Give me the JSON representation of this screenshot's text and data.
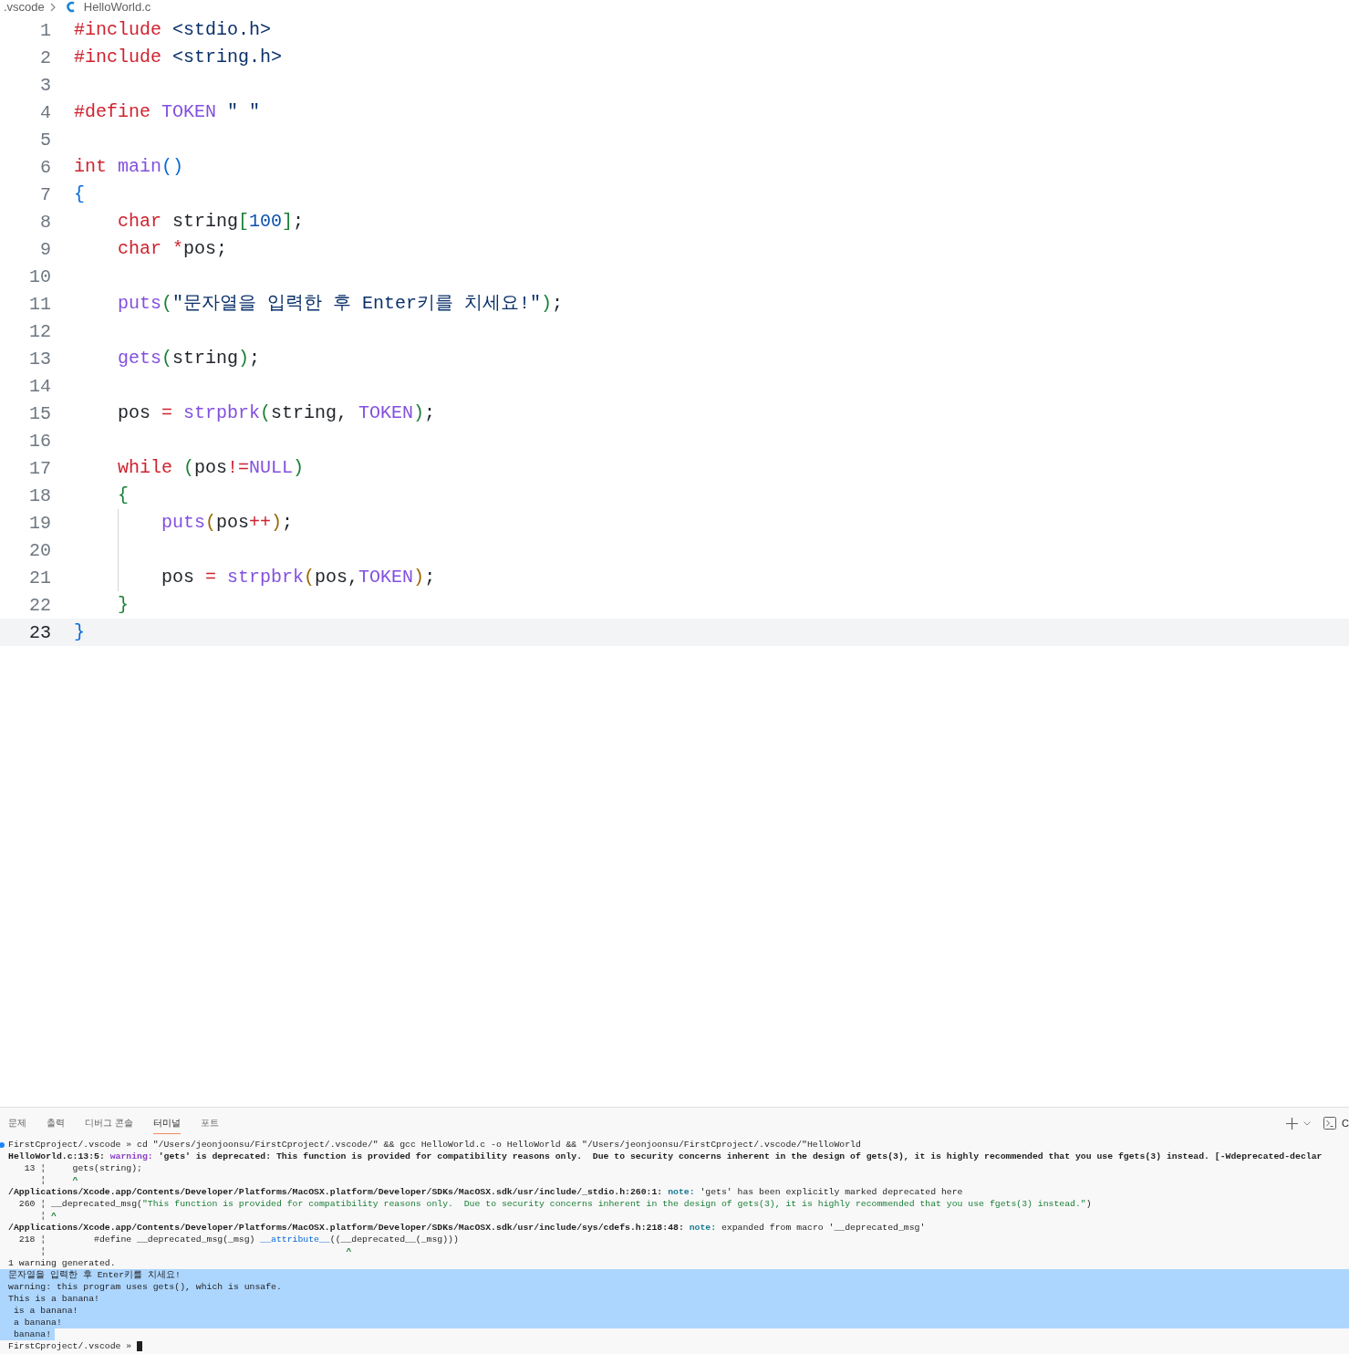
{
  "breadcrumb": {
    "folder": ".vscode",
    "file": "HelloWorld.c"
  },
  "editor": {
    "lines": [
      {
        "number": "1",
        "current": false,
        "guide": false,
        "tokens": [
          {
            "text": "#include",
            "kind": "kw"
          },
          {
            "text": " <stdio.h>",
            "kind": "str"
          }
        ]
      },
      {
        "number": "2",
        "current": false,
        "guide": false,
        "tokens": [
          {
            "text": "#include",
            "kind": "kw"
          },
          {
            "text": " <string.h>",
            "kind": "str"
          }
        ]
      },
      {
        "number": "3",
        "current": false,
        "guide": false
      },
      {
        "number": "4",
        "current": false,
        "guide": false,
        "tokens": [
          {
            "text": "#define",
            "kind": "kw"
          },
          {
            "text": " TOKEN",
            "kind": "macro"
          },
          {
            "text": " \" \"",
            "kind": "str"
          }
        ]
      },
      {
        "number": "5",
        "current": false,
        "guide": false
      },
      {
        "number": "6",
        "current": false,
        "guide": false,
        "tokens": [
          {
            "text": "int",
            "kind": "kw"
          },
          {
            "text": " main",
            "kind": "fn"
          },
          {
            "text": "()",
            "kind": "b1"
          }
        ]
      },
      {
        "number": "7",
        "current": false,
        "guide": false,
        "tokens": [
          {
            "text": "{",
            "kind": "b1"
          }
        ]
      },
      {
        "number": "8",
        "current": false,
        "guide": false,
        "tokens": [
          {
            "text": "    char",
            "kind": "kw"
          },
          {
            "text": " string",
            "kind": "plain"
          },
          {
            "text": "[",
            "kind": "b2"
          },
          {
            "text": "100",
            "kind": "num"
          },
          {
            "text": "]",
            "kind": "b2"
          },
          {
            "text": ";",
            "kind": "plain"
          }
        ]
      },
      {
        "number": "9",
        "current": false,
        "guide": false,
        "tokens": [
          {
            "text": "    char",
            "kind": "kw"
          },
          {
            "text": " *",
            "kind": "op"
          },
          {
            "text": "pos;",
            "kind": "plain"
          }
        ]
      },
      {
        "number": "10",
        "current": false,
        "guide": false
      },
      {
        "number": "11",
        "current": false,
        "guide": false,
        "tokens": [
          {
            "text": "    puts",
            "kind": "fn"
          },
          {
            "text": "(",
            "kind": "b2"
          },
          {
            "text": "\"문자열을 입력한 후 Enter키를 치세요!\"",
            "kind": "str"
          },
          {
            "text": ")",
            "kind": "b2"
          },
          {
            "text": ";",
            "kind": "plain"
          }
        ]
      },
      {
        "number": "12",
        "current": false,
        "guide": false
      },
      {
        "number": "13",
        "current": false,
        "guide": false,
        "tokens": [
          {
            "text": "    gets",
            "kind": "fn"
          },
          {
            "text": "(",
            "kind": "b2"
          },
          {
            "text": "string",
            "kind": "plain"
          },
          {
            "text": ")",
            "kind": "b2"
          },
          {
            "text": ";",
            "kind": "plain"
          }
        ]
      },
      {
        "number": "14",
        "current": false,
        "guide": false
      },
      {
        "number": "15",
        "current": false,
        "guide": false,
        "tokens": [
          {
            "text": "    pos ",
            "kind": "plain"
          },
          {
            "text": "=",
            "kind": "op"
          },
          {
            "text": " strpbrk",
            "kind": "fn"
          },
          {
            "text": "(",
            "kind": "b2"
          },
          {
            "text": "string, ",
            "kind": "plain"
          },
          {
            "text": "TOKEN",
            "kind": "macro"
          },
          {
            "text": ")",
            "kind": "b2"
          },
          {
            "text": ";",
            "kind": "plain"
          }
        ]
      },
      {
        "number": "16",
        "current": false,
        "guide": false
      },
      {
        "number": "17",
        "current": false,
        "guide": false,
        "tokens": [
          {
            "text": "    while",
            "kind": "kw"
          },
          {
            "text": " (",
            "kind": "b2"
          },
          {
            "text": "pos",
            "kind": "plain"
          },
          {
            "text": "!=",
            "kind": "op"
          },
          {
            "text": "NULL",
            "kind": "macro"
          },
          {
            "text": ")",
            "kind": "b2"
          }
        ]
      },
      {
        "number": "18",
        "current": false,
        "guide": false,
        "tokens": [
          {
            "text": "    {",
            "kind": "b2"
          }
        ]
      },
      {
        "number": "19",
        "current": false,
        "guide": true,
        "tokens": [
          {
            "text": "        puts",
            "kind": "fn"
          },
          {
            "text": "(",
            "kind": "b3"
          },
          {
            "text": "pos",
            "kind": "plain"
          },
          {
            "text": "++",
            "kind": "op"
          },
          {
            "text": ")",
            "kind": "b3"
          },
          {
            "text": ";",
            "kind": "plain"
          }
        ]
      },
      {
        "number": "20",
        "current": false,
        "guide": true
      },
      {
        "number": "21",
        "current": false,
        "guide": true,
        "tokens": [
          {
            "text": "        pos ",
            "kind": "plain"
          },
          {
            "text": "=",
            "kind": "op"
          },
          {
            "text": " strpbrk",
            "kind": "fn"
          },
          {
            "text": "(",
            "kind": "b3"
          },
          {
            "text": "pos,",
            "kind": "plain"
          },
          {
            "text": "TOKEN",
            "kind": "macro"
          },
          {
            "text": ")",
            "kind": "b3"
          },
          {
            "text": ";",
            "kind": "plain"
          }
        ]
      },
      {
        "number": "22",
        "current": false,
        "guide": false,
        "tokens": [
          {
            "text": "    }",
            "kind": "b2"
          }
        ]
      },
      {
        "number": "23",
        "current": true,
        "guide": false,
        "tokens": [
          {
            "text": "}",
            "kind": "b1"
          }
        ]
      }
    ]
  },
  "panel": {
    "tabs": [
      {
        "label": "문제",
        "selected": false
      },
      {
        "label": "출력",
        "selected": false
      },
      {
        "label": "디버그 콘솔",
        "selected": false
      },
      {
        "label": "터미널",
        "selected": true
      },
      {
        "label": "포트",
        "selected": false
      }
    ],
    "terminal_label": "C",
    "terminal": [
      {
        "marker": true,
        "selected": false,
        "cursor": false,
        "parts": [
          {
            "text": "FirstCproject/.vscode » cd \"/Users/jeonjoonsu/FirstCproject/.vscode/\" && gcc HelloWorld.c -o HelloWorld && \"/Users/jeonjoonsu/FirstCproject/.vscode/\"HelloWorld",
            "kind": "plain"
          }
        ]
      },
      {
        "marker": false,
        "selected": false,
        "cursor": false,
        "parts": [
          {
            "text": "HelloWorld.c:13:5: ",
            "kind": "bold"
          },
          {
            "text": "warning:",
            "kind": "warning"
          },
          {
            "text": " 'gets' is deprecated: This function is provided for compatibility reasons only.  Due to security concerns inherent in the design of gets(3), it is highly recommended that you use fgets(3) instead. [-Wdeprecated-declar",
            "kind": "bold"
          }
        ]
      },
      {
        "marker": false,
        "selected": false,
        "cursor": false,
        "parts": [
          {
            "text": "   13 ¦     gets(string);",
            "kind": "plain"
          }
        ]
      },
      {
        "marker": false,
        "selected": false,
        "cursor": false,
        "parts": [
          {
            "text": "      ¦     ",
            "kind": "plain"
          },
          {
            "text": "^",
            "kind": "caret"
          }
        ]
      },
      {
        "marker": false,
        "selected": false,
        "cursor": false,
        "parts": [
          {
            "text": "/Applications/Xcode.app/Contents/Developer/Platforms/MacOSX.platform/Developer/SDKs/MacOSX.sdk/usr/include/_stdio.h:260:1: ",
            "kind": "bold"
          },
          {
            "text": "note:",
            "kind": "note"
          },
          {
            "text": " 'gets' has been explicitly marked deprecated here",
            "kind": "plain"
          }
        ]
      },
      {
        "marker": false,
        "selected": false,
        "cursor": false,
        "parts": [
          {
            "text": "  260 ¦ __deprecated_msg(",
            "kind": "plain"
          },
          {
            "text": "\"This function is provided for compatibility reasons only.  Due to security concerns inherent in the design of gets(3), it is highly recommended that you use fgets(3) instead.\"",
            "kind": "string"
          },
          {
            "text": ")",
            "kind": "plain"
          }
        ]
      },
      {
        "marker": false,
        "selected": false,
        "cursor": false,
        "parts": [
          {
            "text": "      ¦ ",
            "kind": "plain"
          },
          {
            "text": "^",
            "kind": "caret"
          }
        ]
      },
      {
        "marker": false,
        "selected": false,
        "cursor": false,
        "parts": [
          {
            "text": "/Applications/Xcode.app/Contents/Developer/Platforms/MacOSX.platform/Developer/SDKs/MacOSX.sdk/usr/include/sys/cdefs.h:218:48: ",
            "kind": "bold"
          },
          {
            "text": "note:",
            "kind": "note"
          },
          {
            "text": " expanded from macro '__deprecated_msg'",
            "kind": "plain"
          }
        ]
      },
      {
        "marker": false,
        "selected": false,
        "cursor": false,
        "parts": [
          {
            "text": "  218 ¦         #define __deprecated_msg(_msg) ",
            "kind": "plain"
          },
          {
            "text": "__attribute__",
            "kind": "attr"
          },
          {
            "text": "((__deprecated__(_msg)))",
            "kind": "plain"
          }
        ]
      },
      {
        "marker": false,
        "selected": false,
        "cursor": false,
        "parts": [
          {
            "text": "      ¦                                                        ",
            "kind": "plain"
          },
          {
            "text": "^",
            "kind": "caret"
          }
        ]
      },
      {
        "marker": false,
        "selected": false,
        "cursor": false,
        "parts": [
          {
            "text": "1 warning generated.",
            "kind": "plain"
          }
        ]
      },
      {
        "marker": false,
        "selected": true,
        "cursor": false,
        "parts": [
          {
            "text": "문자열을 입력한 후 Enter키를 치세요!",
            "kind": "plain"
          }
        ]
      },
      {
        "marker": false,
        "selected": true,
        "cursor": false,
        "parts": [
          {
            "text": "warning: this program uses gets(), which is unsafe.",
            "kind": "plain"
          }
        ]
      },
      {
        "marker": false,
        "selected": true,
        "cursor": false,
        "parts": [
          {
            "text": "This is a banana!",
            "kind": "plain"
          }
        ]
      },
      {
        "marker": false,
        "selected": true,
        "cursor": false,
        "parts": [
          {
            "text": " is a banana!",
            "kind": "plain"
          }
        ]
      },
      {
        "marker": false,
        "selected": true,
        "cursor": false,
        "parts": [
          {
            "text": " a banana!",
            "kind": "plain"
          }
        ]
      },
      {
        "marker": false,
        "selected": true,
        "cursor": false,
        "parts": [
          {
            "text": " banana!",
            "kind": "plain"
          }
        ]
      },
      {
        "marker": false,
        "selected": false,
        "cursor": true,
        "parts": [
          {
            "text": "FirstCproject/.vscode » ",
            "kind": "plain"
          }
        ]
      }
    ]
  }
}
